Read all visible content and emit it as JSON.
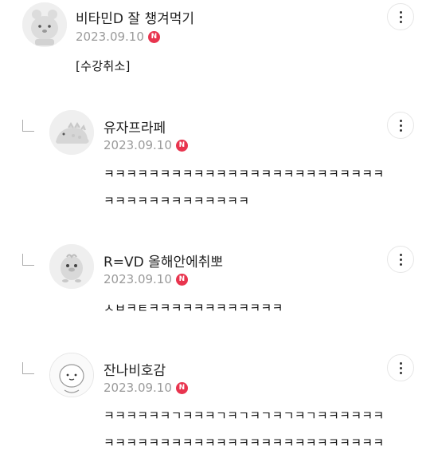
{
  "comments": [
    {
      "author": "비타민D 잘 챙겨먹기",
      "date": "2023.09.10",
      "new_badge": "N",
      "text": "[수강취소]",
      "avatar_icon": "bear-avatar-icon",
      "is_reply": false
    },
    {
      "author": "유자프라페",
      "date": "2023.09.10",
      "new_badge": "N",
      "text": "ㅋㅋㅋㅋㅋㅋㅋㅋㅋㅋㅋㅋㅋㅋㅋㅋㅋㅋㅋㅋㅋㅋㅋㅋㅋㅋㅋㅋㅋㅋㅋㅋㅋㅋㅋㅋㅋㅋ",
      "avatar_icon": "dinosaur-avatar-icon",
      "is_reply": true
    },
    {
      "author": "R=VD 올해안에취뽀",
      "date": "2023.09.10",
      "new_badge": "N",
      "text": "ㅅㅂㅋㅌㅋㅋㅋㅋㅋㅋㅋㅋㅋㅋㅋㅋ",
      "avatar_icon": "chick-avatar-icon",
      "is_reply": true
    },
    {
      "author": "잔나비호감",
      "date": "2023.09.10",
      "new_badge": "N",
      "text": "ㅋㅋㅋㅋㅋㅋㄱㅋㅋㅋㄱㅋㄱㅋㄱㅋㄱㅋㄱㅋㅋㅋㅋㅋㅋㅋㅋㅋㅋㅋㅋㅋㅋㅋㅋㅋㅋㅋㅋㅋㅋㅋㅋㅋㅋㅋㅋㅋㅋㅋㅋㅋㅋ",
      "avatar_icon": "round-face-avatar-icon",
      "is_reply": true
    }
  ],
  "colors": {
    "new_badge": "#e8344e",
    "date": "#9a9a9a",
    "avatar_bg": "#f0f0f0"
  }
}
